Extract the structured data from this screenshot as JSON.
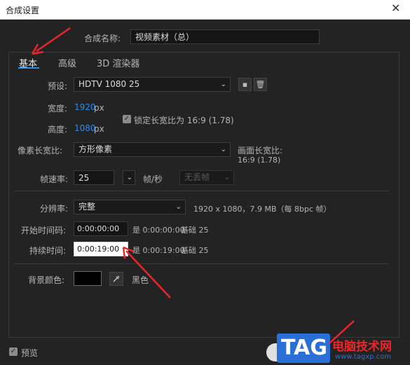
{
  "window": {
    "title": "合成设置",
    "close_glyph": "✕"
  },
  "comp_name": {
    "label": "合成名称:",
    "value": "视频素材（总）"
  },
  "tabs": [
    {
      "label": "基本"
    },
    {
      "label": "高级"
    },
    {
      "label": "3D 渲染器"
    }
  ],
  "preset": {
    "label": "预设:",
    "value": "HDTV 1080 25",
    "save_icon": "save-preset-icon",
    "delete_icon": "trash-icon"
  },
  "width": {
    "label": "宽度:",
    "value": "1920",
    "unit": "px"
  },
  "height": {
    "label": "高度:",
    "value": "1080",
    "unit": "px"
  },
  "lock_aspect": {
    "label": "锁定长宽比为 16:9 (1.78)",
    "checked": true
  },
  "pixel_aspect": {
    "label": "像素长宽比:",
    "value": "方形像素"
  },
  "frame_aspect": {
    "label": "画面长宽比:",
    "value": "16:9 (1.78)"
  },
  "frame_rate": {
    "label": "帧速率:",
    "value": "25",
    "unit": "帧/秒",
    "drop_frame": "无丢帧"
  },
  "resolution": {
    "label": "分辨率:",
    "value": "完整",
    "info": "1920 x 1080，7.9 MB（每 8bpc 帧）"
  },
  "start_timecode": {
    "label": "开始时间码:",
    "value": "0:00:00:00",
    "equals": "是 0:00:00:00",
    "base": "基础 25"
  },
  "duration": {
    "label": "持续时间:",
    "value": "0:00:19:00",
    "equals": "是 0:00:19:00",
    "base": "基础 25"
  },
  "bg_color": {
    "label": "背景颜色:",
    "color": "#000000",
    "name": "黑色",
    "eyedropper_icon": "eyedropper-icon"
  },
  "preview": {
    "label": "预览",
    "checked": true
  },
  "watermark": {
    "logo": "TAG",
    "site_name": "电脑技术网",
    "url": "www.tagxp.com"
  },
  "colors": {
    "accent": "#2d8ceb",
    "annotation_arrow": "#e8262b"
  }
}
